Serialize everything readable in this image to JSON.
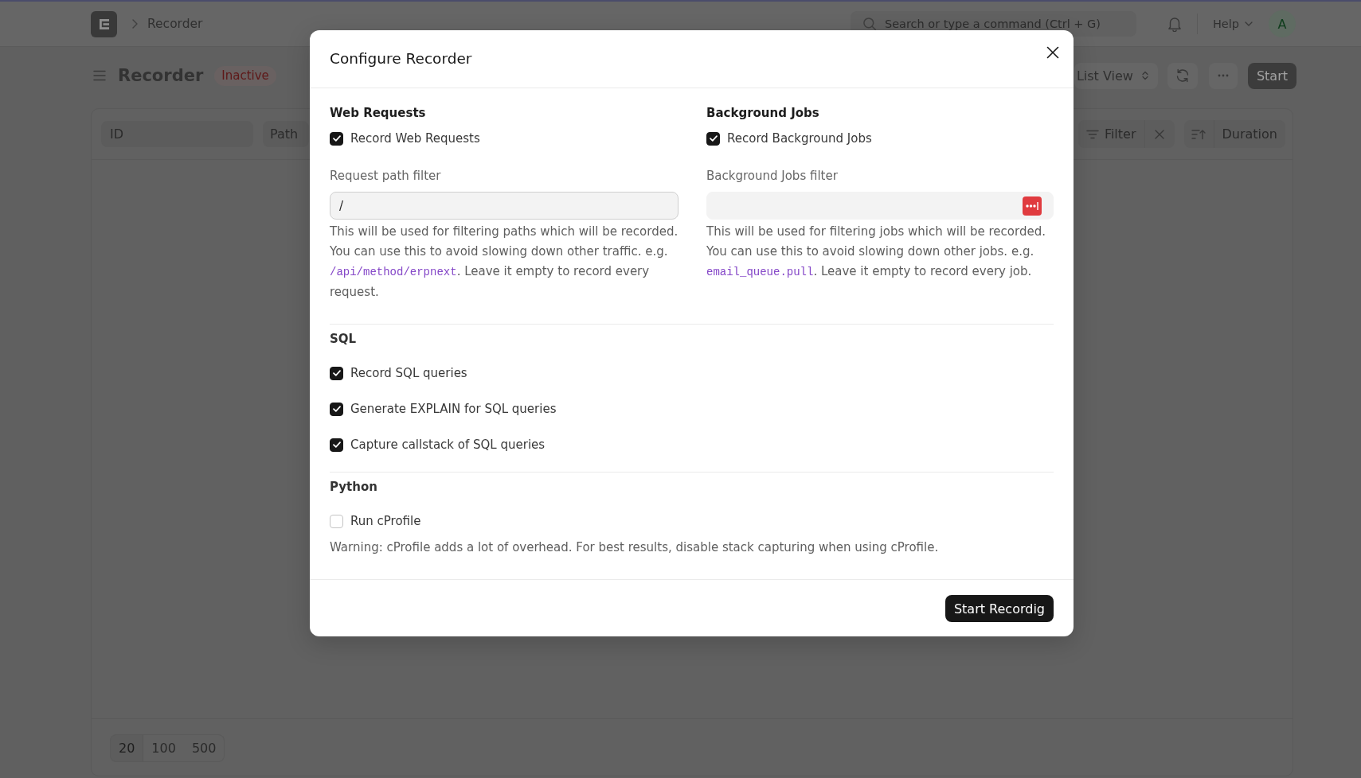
{
  "navbar": {
    "breadcrumbs": [
      "Recorder"
    ],
    "search": {
      "placeholder": "Search or type a command (Ctrl + G)"
    },
    "help": "Help",
    "avatar": "A"
  },
  "page_header": {
    "title": "Recorder",
    "status": "Inactive",
    "view_switcher": "List View",
    "primary_action": "Start"
  },
  "list": {
    "filters": [
      {
        "placeholder": "ID"
      },
      {
        "placeholder": "Path"
      }
    ],
    "filter_button": "Filter",
    "sort_by": "Duration",
    "page_sizes": [
      {
        "label": "20",
        "selected": true
      },
      {
        "label": "100",
        "selected": false
      },
      {
        "label": "500",
        "selected": false
      }
    ]
  },
  "dialog": {
    "title": "Configure Recorder",
    "sections": [
      {
        "kind": "columns",
        "columns": [
          {
            "heading": "Web Requests",
            "checkbox": {
              "label": "Record Web Requests",
              "checked": true
            },
            "field": {
              "label": "Request path filter",
              "value": "/",
              "focused": true,
              "autofill_icon": false
            },
            "description": [
              {
                "kind": "text",
                "text": "This will be used for filtering paths which will be recorded. You can use this to avoid slowing down other traffic. e.g. "
              },
              {
                "kind": "code",
                "text": "/api/method/erpnext"
              },
              {
                "kind": "text",
                "text": ". Leave it empty to record every request."
              }
            ]
          },
          {
            "heading": "Background Jobs",
            "checkbox": {
              "label": "Record Background Jobs",
              "checked": true
            },
            "field": {
              "label": "Background Jobs filter",
              "focused": false,
              "autofill_icon": true
            },
            "description": [
              {
                "kind": "text",
                "text": "This will be used for filtering jobs which will be recorded. You can use this to avoid slowing down other jobs. e.g. "
              },
              {
                "kind": "code",
                "text": "email_queue.pull"
              },
              {
                "kind": "text",
                "text": ". Leave it empty to record every job."
              }
            ]
          }
        ]
      },
      {
        "kind": "checklist",
        "heading": "SQL",
        "checkboxes": [
          {
            "label": "Record SQL queries",
            "checked": true
          },
          {
            "label": "Generate EXPLAIN for SQL queries",
            "checked": true
          },
          {
            "label": "Capture callstack of SQL queries",
            "checked": true
          }
        ]
      },
      {
        "kind": "checklist",
        "heading": "Python",
        "checkboxes": [
          {
            "label": "Run cProfile",
            "checked": false
          }
        ],
        "note": "Warning: cProfile adds a lot of overhead. For best results, disable stack capturing when using cProfile."
      }
    ],
    "primary_action": "Start Recordig"
  }
}
